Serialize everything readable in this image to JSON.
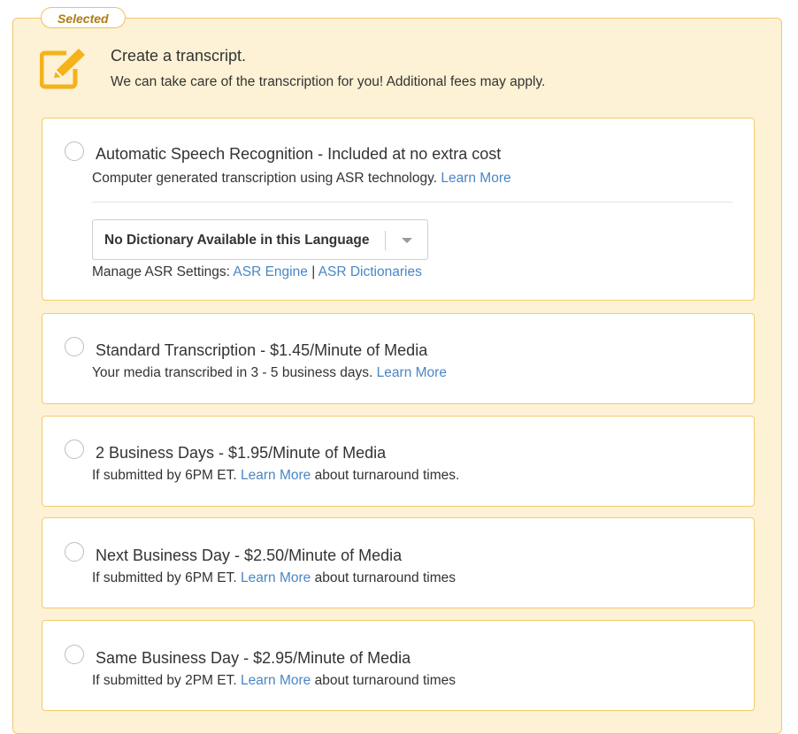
{
  "badge": "Selected",
  "header": {
    "title": "Create a transcript.",
    "subtitle": "We can take care of the transcription for you! Additional fees may apply."
  },
  "asr": {
    "title": "Automatic Speech Recognition - Included at no extra cost",
    "desc": "Computer generated transcription using ASR technology.",
    "learn_more": "Learn More",
    "dictionary_select": "No Dictionary Available in this Language",
    "manage_label": "Manage ASR Settings:",
    "engine_link": "ASR Engine",
    "separator": "|",
    "dictionaries_link": "ASR Dictionaries"
  },
  "standard": {
    "title": "Standard Transcription - $1.45/Minute of Media",
    "desc": "Your media transcribed in 3 - 5 business days.",
    "learn_more": "Learn More"
  },
  "two_day": {
    "title": "2 Business Days - $1.95/Minute of Media",
    "desc_prefix": "If submitted by 6PM ET.",
    "learn_more": "Learn More",
    "desc_suffix": "about turnaround times."
  },
  "next_day": {
    "title": "Next Business Day - $2.50/Minute of Media",
    "desc_prefix": "If submitted by 6PM ET.",
    "learn_more": "Learn More",
    "desc_suffix": "about turnaround times"
  },
  "same_day": {
    "title": "Same Business Day - $2.95/Minute of Media",
    "desc_prefix": "If submitted by 2PM ET.",
    "learn_more": "Learn More",
    "desc_suffix": "about turnaround times"
  },
  "colors": {
    "accent": "#f5b21b",
    "panel_bg": "#fdf2d5",
    "card_border": "#f3cc6a",
    "link": "#4a86c5"
  },
  "icons": {
    "header": "edit-icon"
  }
}
